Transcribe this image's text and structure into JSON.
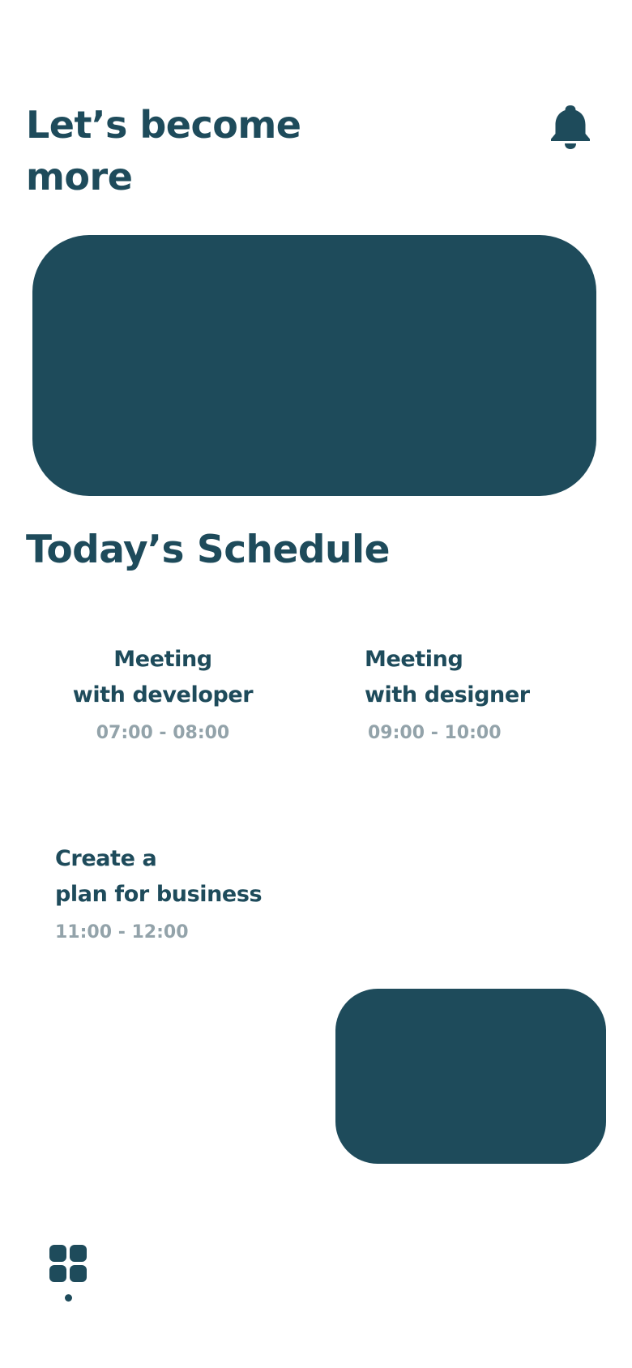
{
  "header": {
    "title_line1": "Let’s become",
    "title_line2": "more",
    "notification_icon": "bell-icon"
  },
  "schedule": {
    "title": "Today’s Schedule",
    "items": [
      {
        "line1": "Meeting",
        "line2": "with developer",
        "time": "07:00 - 08:00"
      },
      {
        "line1": "Meeting",
        "line2": "with designer",
        "time": "09:00 - 10:00"
      },
      {
        "line1": "Create a",
        "line2": "plan for business",
        "time": "11:00 - 12:00"
      }
    ]
  },
  "bottom_nav": {
    "items": [
      {
        "icon": "grid-icon",
        "active": true
      }
    ]
  },
  "colors": {
    "primary": "#1e4b5b",
    "muted_text": "#93a3aa",
    "background": "#ffffff"
  }
}
